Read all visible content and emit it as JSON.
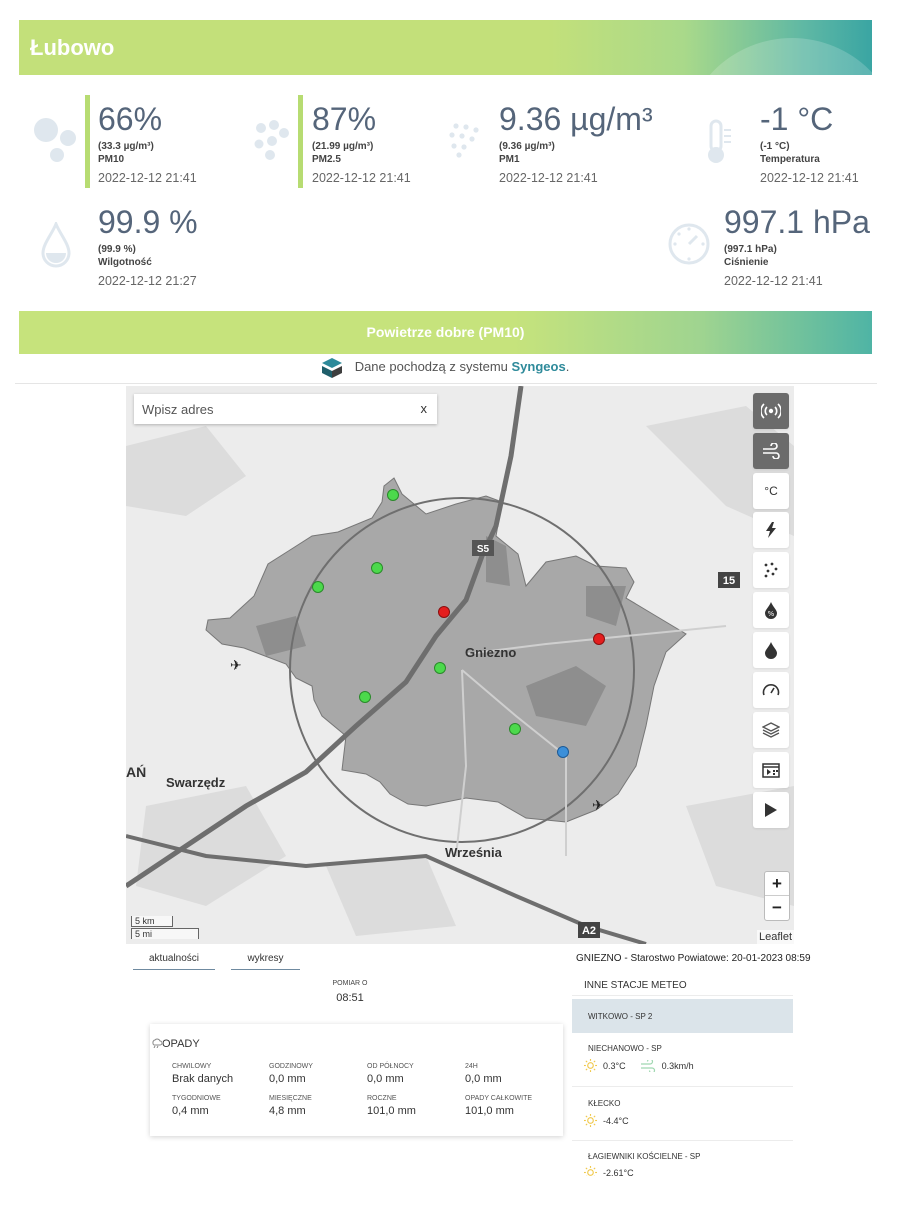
{
  "banner": {
    "title": "Łubowo"
  },
  "metrics": {
    "pm10": {
      "value": "66%",
      "sub": "(33.3 µg/m³)",
      "label": "PM10",
      "time": "2022-12-12 21:41",
      "icon": "pm10-dots-icon"
    },
    "pm25": {
      "value": "87%",
      "sub": "(21.99 µg/m³)",
      "label": "PM2.5",
      "time": "2022-12-12 21:41",
      "icon": "pm25-dots-icon"
    },
    "pm1": {
      "value": "9.36 µg/m³",
      "sub": "(9.36 µg/m³)",
      "label": "PM1",
      "time": "2022-12-12 21:41",
      "icon": "pm1-dots-icon"
    },
    "temperature": {
      "value": "-1 °C",
      "sub": "(-1 °C)",
      "label": "Temperatura",
      "time": "2022-12-12 21:41",
      "icon": "thermometer-icon"
    },
    "humidity": {
      "value": "99.9 %",
      "sub": "(99.9 %)",
      "label": "Wilgotność",
      "time": "2022-12-12 21:27",
      "icon": "drop-icon"
    },
    "pressure": {
      "value": "997.1 hPa",
      "sub": "(997.1 hPa)",
      "label": "Ciśnienie",
      "time": "2022-12-12 21:41",
      "icon": "gauge-icon"
    }
  },
  "status": {
    "text": "Powietrze dobre (PM10)",
    "color": "#c6e37c"
  },
  "source": {
    "prefix": "Dane pochodzą z systemu ",
    "brand": "Syngeos",
    "suffix": "."
  },
  "map": {
    "search_placeholder": "Wpisz adres",
    "search_clear": "x",
    "labels": {
      "gniezno": "Gniezno",
      "wrzesnia": "Września",
      "swarzedz": "Swarzędz",
      "an": "AŃ",
      "road15": "15",
      "roadS5": "S5",
      "roadA2": "A2"
    },
    "tools": {
      "temp_label": "°C"
    },
    "zoom_in": "+",
    "zoom_out": "−",
    "attribution": "Leaflet",
    "scale_km": "5 km",
    "scale_mi": "5 mi",
    "marker_colors": {
      "good": "#4cd94c",
      "bad": "#e41e1e",
      "neutral": "#3b8fd9"
    }
  },
  "tabs": [
    {
      "label": "aktualności"
    },
    {
      "label": "wykresy"
    }
  ],
  "station_header": "GNIEZNO - Starostwo Powiatowe: 20-01-2023 08:59",
  "pomiar": {
    "label": "POMIAR O",
    "time": "08:51"
  },
  "opady": {
    "title": "OPADY",
    "cells": [
      {
        "key": "CHWILOWY",
        "value": "Brak danych"
      },
      {
        "key": "GODZINOWY",
        "value": "0,0 mm"
      },
      {
        "key": "OD PÓŁNOCY",
        "value": "0,0 mm"
      },
      {
        "key": "24H",
        "value": "0,0 mm"
      },
      {
        "key": "TYGODNIOWE",
        "value": "0,4 mm"
      },
      {
        "key": "MIESIĘCZNE",
        "value": "4,8 mm"
      },
      {
        "key": "ROCZNE",
        "value": "101,0 mm"
      },
      {
        "key": "OPADY CAŁKOWITE",
        "value": "101,0 mm"
      }
    ]
  },
  "other_stations": {
    "title": "INNE STACJE METEO",
    "stations": [
      {
        "name": "WITKOWO - SP 2"
      },
      {
        "name": "NIECHANOWO - SP",
        "temp": "0.3°C",
        "wind": "0.3km/h"
      },
      {
        "name": "KŁECKO",
        "temp": "-4.4°C"
      },
      {
        "name": "ŁAGIEWNIKI KOŚCIELNE - SP",
        "temp": "-2.61°C"
      }
    ]
  }
}
